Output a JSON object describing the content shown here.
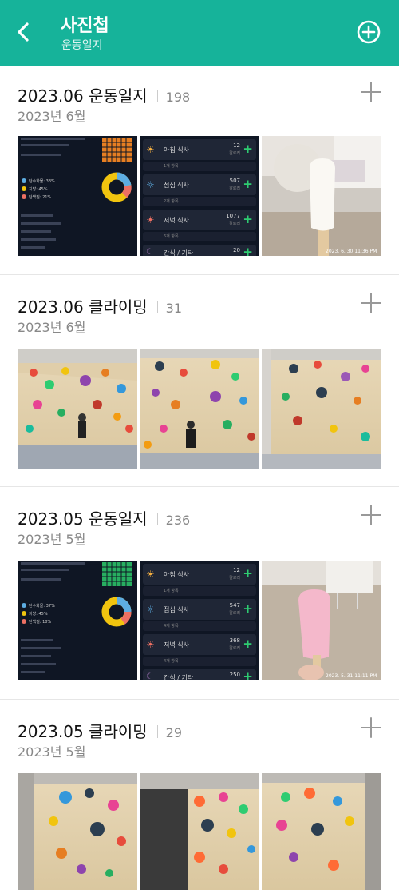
{
  "header": {
    "title": "사진첩",
    "subtitle": "운동일지"
  },
  "albums": [
    {
      "title": "2023.06 운동일지",
      "count": "198",
      "date": "2023년 6월",
      "timestamp": "2023. 6. 30 11:36 PM"
    },
    {
      "title": "2023.06 클라이밍",
      "count": "31",
      "date": "2023년 6월"
    },
    {
      "title": "2023.05 운동일지",
      "count": "236",
      "date": "2023년 5월",
      "timestamp": "2023. 5. 31 11:11 PM"
    },
    {
      "title": "2023.05 클라이밍",
      "count": "29",
      "date": "2023년 5월"
    }
  ],
  "diet_app": {
    "june": {
      "meals": [
        {
          "label": "아침 식사",
          "kcal": "12",
          "unit": "칼로리",
          "sub": "1개 항목"
        },
        {
          "label": "점심 식사",
          "kcal": "507",
          "unit": "칼로리",
          "sub": "2개 항목"
        },
        {
          "label": "저녁 식사",
          "kcal": "1077",
          "unit": "칼로리",
          "sub": "6개 항목"
        },
        {
          "label": "간식 / 기타",
          "kcal": "20",
          "unit": "칼로리",
          "sub": ""
        }
      ],
      "stats": [
        {
          "label": "탄수화물: 33%"
        },
        {
          "label": "지방: 45%"
        },
        {
          "label": "단백질: 21%"
        }
      ]
    },
    "may": {
      "meals": [
        {
          "label": "아침 식사",
          "kcal": "12",
          "unit": "칼로리",
          "sub": "1개 항목"
        },
        {
          "label": "점심 식사",
          "kcal": "547",
          "unit": "칼로리",
          "sub": "4개 항목"
        },
        {
          "label": "저녁 식사",
          "kcal": "368",
          "unit": "칼로리",
          "sub": "4개 항목"
        },
        {
          "label": "간식 / 기타",
          "kcal": "250",
          "unit": "칼로리",
          "sub": ""
        }
      ],
      "stats": [
        {
          "label": "탄수화물: 37%"
        },
        {
          "label": "지방: 45%"
        },
        {
          "label": "단백질: 18%"
        }
      ]
    }
  },
  "colors": {
    "accent": "#16b39a",
    "plus_green": "#2ecc71"
  }
}
